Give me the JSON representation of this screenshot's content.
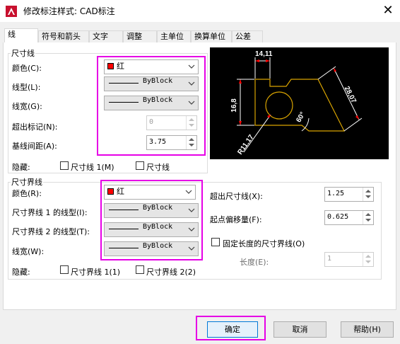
{
  "window": {
    "title": "修改标注样式: CAD标注",
    "close_glyph": "✕",
    "app_icon": "autocad-icon"
  },
  "tabs": [
    {
      "label": "线",
      "active": true
    },
    {
      "label": "符号和箭头",
      "active": false
    },
    {
      "label": "文字",
      "active": false
    },
    {
      "label": "调整",
      "active": false
    },
    {
      "label": "主单位",
      "active": false
    },
    {
      "label": "换算单位",
      "active": false
    },
    {
      "label": "公差",
      "active": false
    }
  ],
  "dim_lines": {
    "group_label": "尺寸线",
    "color_label": "颜色(C):",
    "color_value": "红",
    "linetype_label": "线型(L):",
    "linetype_value": "ByBlock",
    "lineweight_label": "线宽(G):",
    "lineweight_value": "ByBlock",
    "extend_label": "超出标记(N):",
    "extend_value": "0",
    "baseline_label": "基线间距(A):",
    "baseline_value": "3.75",
    "suppress_label": "隐藏:",
    "suppress_1": "尺寸线 1(M)",
    "suppress_2": "尺寸线"
  },
  "ext_lines": {
    "group_label": "尺寸界线",
    "color_label": "颜色(R):",
    "color_value": "红",
    "linetype1_label": "尺寸界线 1 的线型(I):",
    "linetype1_value": "ByBlock",
    "linetype2_label": "尺寸界线 2 的线型(T):",
    "linetype2_value": "ByBlock",
    "lineweight_label": "线宽(W):",
    "lineweight_value": "ByBlock",
    "suppress_label": "隐藏:",
    "suppress_1": "尺寸界线 1(1)",
    "suppress_2": "尺寸界线 2(2)",
    "beyond_label": "超出尺寸线(X):",
    "beyond_value": "1.25",
    "offset_label": "起点偏移量(F):",
    "offset_value": "0.625",
    "fixed_label": "固定长度的尺寸界线(O)",
    "length_label": "长度(E):",
    "length_value": "1"
  },
  "preview": {
    "dim_top": "14,11",
    "dim_left": "16,8",
    "dim_right": "28,07",
    "dim_angle": "60°",
    "dim_radius": "R11,17"
  },
  "buttons": {
    "ok": "确定",
    "cancel": "取消",
    "help": "帮助(H)"
  },
  "colors": {
    "highlight": "#e600e6",
    "swatch": "#ff0000",
    "preview_geometry": "#d9a400",
    "preview_dims": "#ffffff",
    "preview_arrows": "#ff0000"
  }
}
